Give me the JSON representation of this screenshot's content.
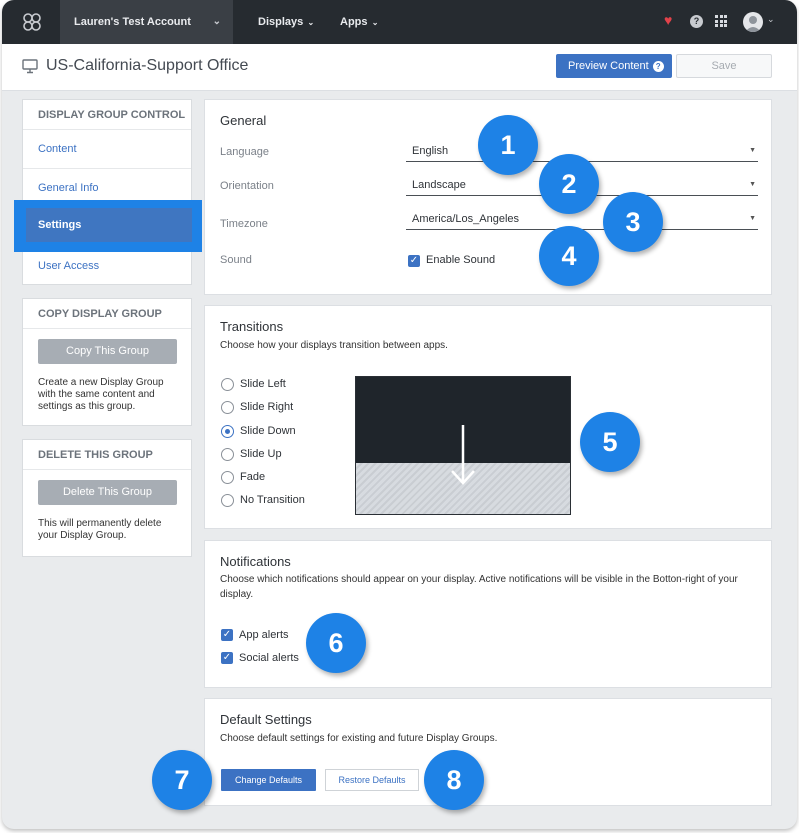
{
  "topbar": {
    "account": "Lauren's Test Account",
    "nav": [
      {
        "label": "Displays"
      },
      {
        "label": "Apps"
      }
    ],
    "help_glyph": "?"
  },
  "header": {
    "title": "US-California-Support Office",
    "preview_label": "Preview Content",
    "preview_icon": "?",
    "save_label": "Save"
  },
  "sidebar": {
    "control_title": "DISPLAY GROUP CONTROL",
    "items": [
      {
        "label": "Content"
      },
      {
        "label": "General Info"
      },
      {
        "label": "Settings",
        "active": true
      },
      {
        "label": "User Access"
      }
    ],
    "copy": {
      "title": "COPY DISPLAY GROUP",
      "button": "Copy This Group",
      "text": "Create a new Display Group with the same content and settings as this group."
    },
    "delete": {
      "title": "DELETE THIS GROUP",
      "button": "Delete This Group",
      "text": "This will permanently delete your Display Group."
    }
  },
  "general": {
    "title": "General",
    "language_label": "Language",
    "language_value": "English",
    "orientation_label": "Orientation",
    "orientation_value": "Landscape",
    "timezone_label": "Timezone",
    "timezone_value": "America/Los_Angeles",
    "sound_label": "Sound",
    "sound_option": "Enable Sound",
    "sound_checked": true
  },
  "transitions": {
    "title": "Transitions",
    "desc": "Choose how your displays transition between apps.",
    "options": [
      "Slide Left",
      "Slide Right",
      "Slide Down",
      "Slide Up",
      "Fade",
      "No Transition"
    ],
    "selected": "Slide Down"
  },
  "notifications": {
    "title": "Notifications",
    "desc": "Choose which notifications should appear on your display. Active notifications will be visible in the Botton-right of your display.",
    "options": [
      {
        "label": "App alerts",
        "checked": true
      },
      {
        "label": "Social alerts",
        "checked": true
      }
    ]
  },
  "defaults": {
    "title": "Default Settings",
    "desc": "Choose default settings for existing and future Display Groups.",
    "change_label": "Change Defaults",
    "restore_label": "Restore Defaults"
  },
  "callouts": [
    "1",
    "2",
    "3",
    "4",
    "5",
    "6",
    "7",
    "8"
  ],
  "colors": {
    "accent": "#3c72c3",
    "callout": "#1e82e6",
    "topbar": "#262b30",
    "heart": "#e2424a"
  }
}
